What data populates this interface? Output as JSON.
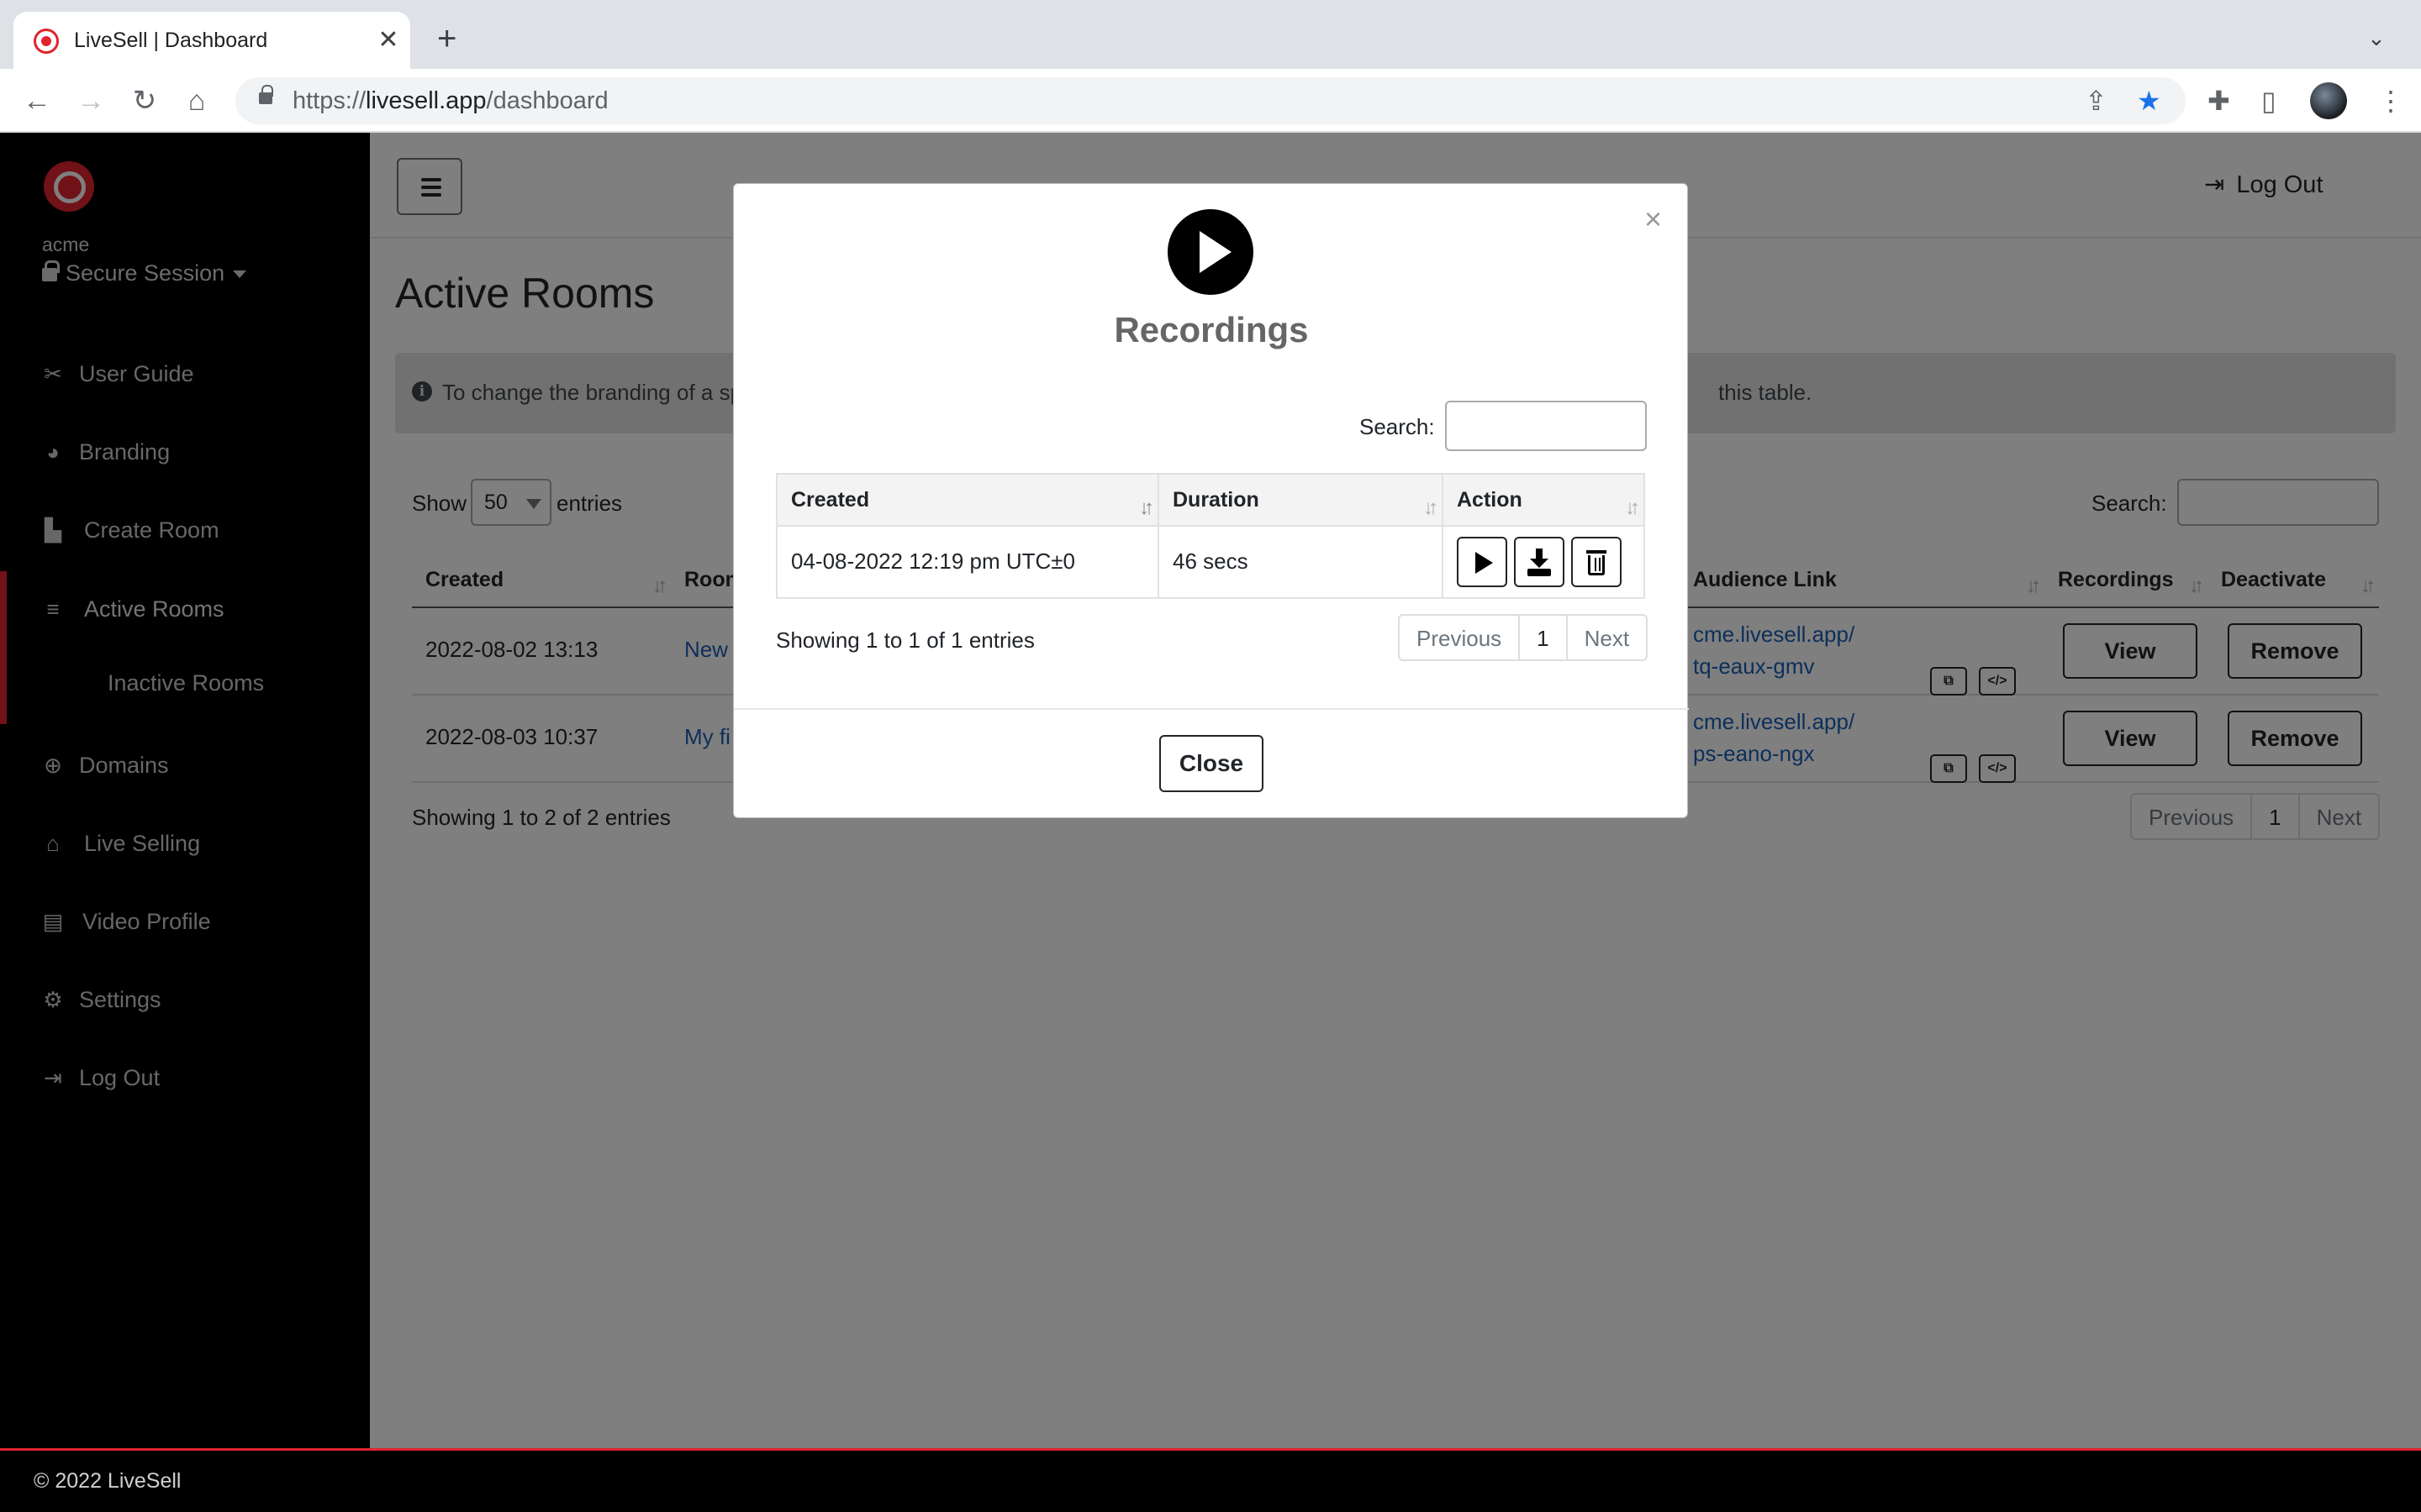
{
  "browser": {
    "tab_title": "LiveSell | Dashboard",
    "url_scheme": "https://",
    "url_host": "livesell.app",
    "url_path": "/dashboard"
  },
  "sidebar": {
    "org": "acme",
    "session": "Secure Session",
    "items": [
      {
        "label": "User Guide",
        "icon": "tools-icon"
      },
      {
        "label": "Branding",
        "icon": "palette-icon"
      },
      {
        "label": "Create Room",
        "icon": "building-icon"
      },
      {
        "label": "Active Rooms",
        "icon": "list-icon"
      },
      {
        "label": "Inactive Rooms",
        "icon": ""
      },
      {
        "label": "Domains",
        "icon": "globe-icon"
      },
      {
        "label": "Live Selling",
        "icon": "store-icon"
      },
      {
        "label": "Video Profile",
        "icon": "id-card-icon"
      },
      {
        "label": "Settings",
        "icon": "gear-icon"
      },
      {
        "label": "Log Out",
        "icon": "sign-out-icon"
      }
    ]
  },
  "topbar": {
    "logout": "Log Out"
  },
  "page": {
    "title": "Active Rooms",
    "alert_start": "To change the branding of a sp",
    "alert_end": "this table.",
    "show_label": "Show",
    "entries_value": "50",
    "entries_label": "entries",
    "search_label": "Search:",
    "columns": [
      "Created",
      "Room",
      "Audience Link",
      "Recordings",
      "Deactivate"
    ],
    "rows": [
      {
        "created": "2022-08-02 13:13",
        "room": "New",
        "link1": "cme.livesell.app/",
        "link2": "tq-eaux-gmv",
        "view": "View",
        "remove": "Remove"
      },
      {
        "created": "2022-08-03 10:37",
        "room": "My fi",
        "link1": "cme.livesell.app/",
        "link2": "ps-eano-ngx",
        "view": "View",
        "remove": "Remove"
      }
    ],
    "info": "Showing 1 to 2 of 2 entries",
    "pager": {
      "prev": "Previous",
      "page": "1",
      "next": "Next"
    }
  },
  "modal": {
    "title": "Recordings",
    "close_x": "×",
    "search_label": "Search:",
    "columns": [
      "Created",
      "Duration",
      "Action"
    ],
    "row": {
      "created": "04-08-2022 12:19 pm UTC±0",
      "duration": "46 secs"
    },
    "info": "Showing 1 to 1 of 1 entries",
    "pager": {
      "prev": "Previous",
      "page": "1",
      "next": "Next"
    },
    "close_button": "Close"
  },
  "footer": {
    "text": "© 2022 LiveSell"
  },
  "colors": {
    "brand_red": "#e0242e",
    "sidebar_bg": "#000000",
    "link": "#1a5fb4"
  }
}
